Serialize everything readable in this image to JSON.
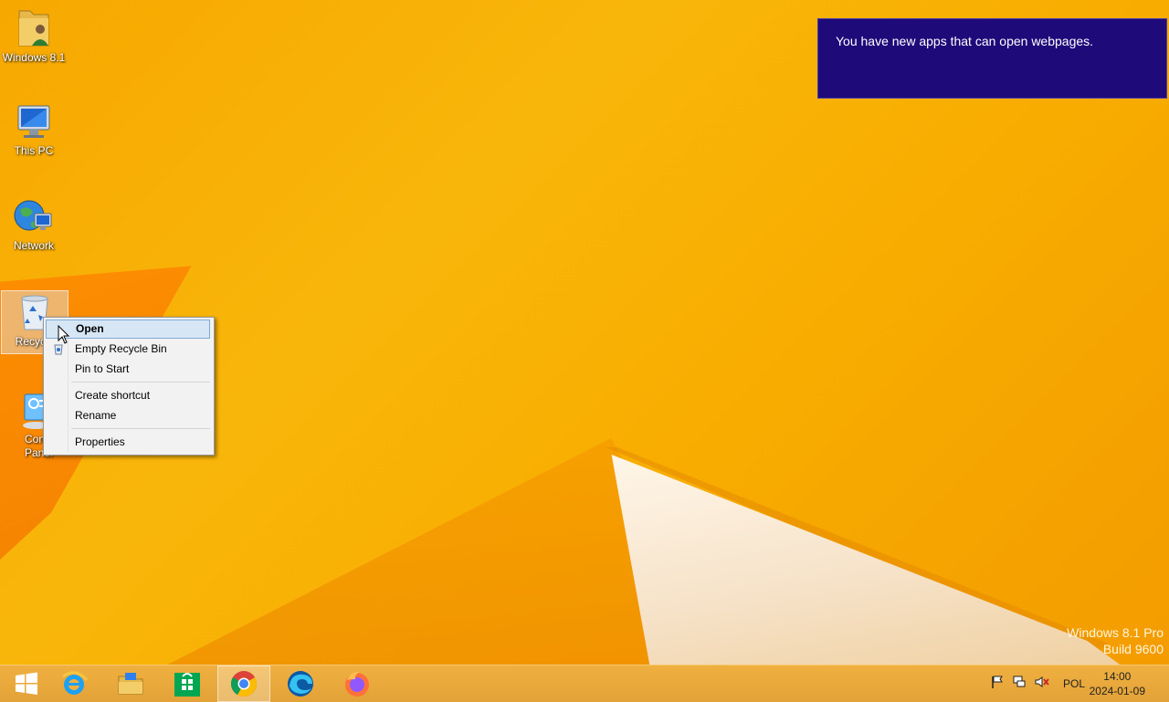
{
  "desktop": {
    "icons": [
      {
        "label": "Windows 8.1"
      },
      {
        "label": "This PC"
      },
      {
        "label": "Network"
      },
      {
        "label": "Recycle Bin",
        "visible_label": "Recycle"
      },
      {
        "label": "Control Panel",
        "visible_label": "Contr Panel"
      }
    ]
  },
  "notification": {
    "text": "You have new apps that can open webpages."
  },
  "context_menu": {
    "items": [
      "Open",
      "Empty Recycle Bin",
      "Pin to Start",
      "Create shortcut",
      "Rename",
      "Properties"
    ]
  },
  "watermark": {
    "line1": "Windows 8.1 Pro",
    "line2": "Build 9600"
  },
  "taskbar": {
    "apps": [
      "start-icon",
      "internet-explorer-icon",
      "file-explorer-icon",
      "store-icon",
      "chrome-icon",
      "edge-icon",
      "firefox-icon"
    ],
    "language": "POL",
    "time": "14:00",
    "date": "2024-01-09"
  },
  "colors": {
    "notification_bg": "#1f0a7a",
    "menu_highlight": "#d7e6f5",
    "wallpaper": "#f8b000"
  }
}
